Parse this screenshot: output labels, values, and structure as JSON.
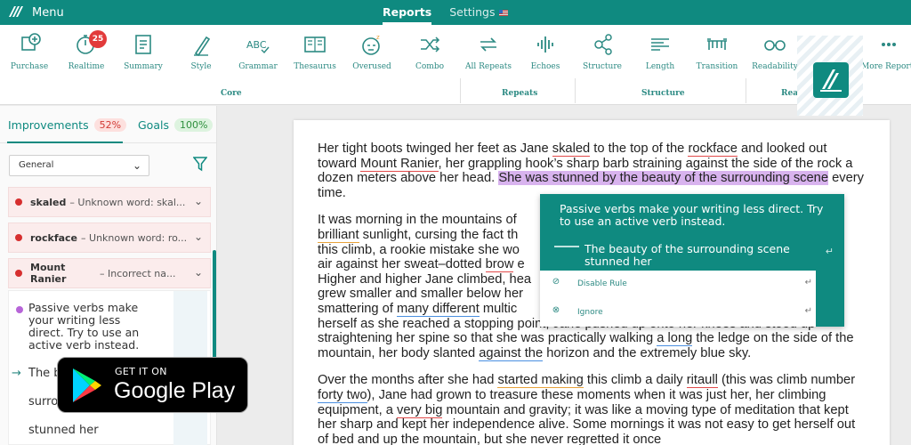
{
  "topbar": {
    "menu_label": "Menu",
    "tabs": [
      {
        "label": "Reports",
        "active": true
      },
      {
        "label": "Settings",
        "active": false
      }
    ],
    "color": "#0f8a80"
  },
  "toolbar": {
    "tools": [
      {
        "label": "Purchase",
        "icon": "plus-circle-icon"
      },
      {
        "label": "Realtime",
        "icon": "stopwatch-icon",
        "badge": "25"
      },
      {
        "label": "Summary",
        "icon": "clipboard-icon"
      },
      {
        "label": "Style",
        "icon": "pencil-icon"
      },
      {
        "label": "Grammar",
        "icon": "abc-check-icon"
      },
      {
        "label": "Thesaurus",
        "icon": "book-icon"
      },
      {
        "label": "Overused",
        "icon": "sleepy-face-icon"
      },
      {
        "label": "Combo",
        "icon": "shuffle-icon"
      },
      {
        "label": "All Repeats",
        "icon": "repeat-icon"
      },
      {
        "label": "Echoes",
        "icon": "soundwave-icon"
      },
      {
        "label": "Structure",
        "icon": "network-icon"
      },
      {
        "label": "Length",
        "icon": "ruler-lines-icon"
      },
      {
        "label": "Transition",
        "icon": "bridge-icon"
      },
      {
        "label": "Readability",
        "icon": "glasses-icon"
      },
      {
        "label": "More Reports",
        "icon": "more-icon"
      }
    ],
    "groups": {
      "core": "Core",
      "repeats": "Repeats",
      "structure": "Structure",
      "rea": "Rea"
    }
  },
  "sidebar": {
    "tabs": [
      {
        "label": "Improvements",
        "count": "52%"
      },
      {
        "label": "Goals",
        "count": "100%"
      }
    ],
    "filter_value": "General",
    "issues": [
      {
        "word": "skaled",
        "desc": "– Unknown word: skal..."
      },
      {
        "word": "rockface",
        "desc": "– Unknown word: ro..."
      },
      {
        "word": "Mount Ranier",
        "desc": "– Incorrect na..."
      }
    ],
    "panel": {
      "text": "Passive verbs make your writing less direct. Try to use an active verb instead.",
      "line1": "The b",
      "line2": "surro",
      "line3": "stunned her"
    }
  },
  "google_play": {
    "line1": "GET IT ON",
    "line2": "Google Play"
  },
  "document": {
    "p1": {
      "a": "Her tight boots twinged her feet as Jane ",
      "skaled": "skaled",
      "b": " to the top of the ",
      "rockface": "rockface",
      "c": " and looked out toward ",
      "mount": "Mount Ranier",
      "d": ", her grappling hook’s sharp barb straining against the side of the rock a dozen meters above her head. ",
      "highlight": "She was stunned by the beauty of the surrounding scene",
      "e": " every time."
    },
    "p2": {
      "a": "It was morning in the mountains of",
      "brilliant": "brilliant",
      "b": " sunlight, cursing the fact th",
      "c": "this climb, a rookie mistake she wo",
      "d": "air against her sweat–dotted ",
      "brow": "brow",
      "e": " e",
      "f": "Higher and higher Jane climbed, hea",
      "g": "grew smaller and smaller below her",
      "h": "smattering of ",
      "many": "many different",
      "i": " multic",
      "j": "herself as she reached a stopping point, Jane pushed up onto her knees and stood up straightening her spine so that she was practically walking ",
      "along": "a long",
      "k": " the ledge on the side of the mountain, her body slanted ",
      "against": "against  the",
      "l": " horizon and the extremely blue sky."
    },
    "p3": {
      "a": "Over the months after she had ",
      "started": "started making",
      "b": " this climb a daily ",
      "ritaull": "ritaull",
      "c": " (this was climb number ",
      "forty": "forty two",
      "d": "), Jane had grown to treasure these moments when it was just her, her climbing equipment, a ",
      "verybig": "very big",
      "e": " mountain and gravity; it was like a moving type of meditation that kept her sharp and kept her independence alive. Some mornings it was not easy to get herself out of bed and up the mountain, but she never regretted it once"
    }
  },
  "popup": {
    "message": "Passive verbs make your writing less direct. Try to use an active verb instead.",
    "suggestion": "The beauty of the surrounding scene stunned her",
    "disable": "Disable Rule",
    "ignore": "Ignore"
  }
}
